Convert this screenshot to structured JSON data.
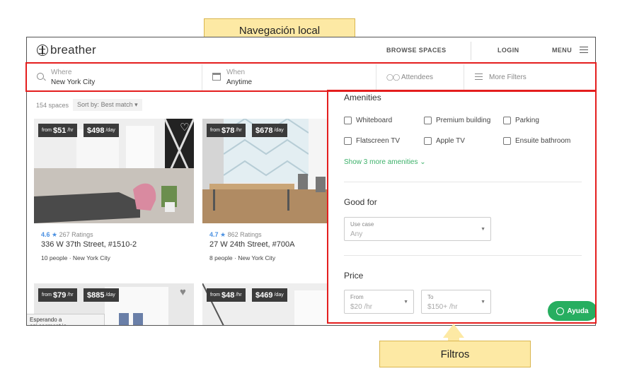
{
  "annotations": {
    "top_callout": "Navegación local",
    "bottom_callout": "Filtros"
  },
  "header": {
    "logo_text": "breather",
    "browse_label": "BROWSE SPACES",
    "login_label": "LOGIN",
    "menu_label": "MENU"
  },
  "search": {
    "where_label": "Where",
    "where_value": "New York City",
    "when_label": "When",
    "when_value": "Anytime",
    "attendees_label": "Attendees",
    "more_filters_label": "More Filters"
  },
  "results": {
    "count": "154 spaces",
    "sort_label": "Sort by:",
    "sort_value": "Best match",
    "cards": [
      {
        "from": "from",
        "hourly": "$51",
        "hourly_unit": "/hr",
        "daily": "$498",
        "daily_unit": "/day",
        "score": "4.6",
        "ratings": "267 Ratings",
        "address": "336 W 37th Street, #1510-2",
        "people": "10 people",
        "city": "New York City"
      },
      {
        "from": "from",
        "hourly": "$78",
        "hourly_unit": "/hr",
        "daily": "$678",
        "daily_unit": "/day",
        "score": "4.7",
        "ratings": "862 Ratings",
        "address": "27 W 24th Street, #700A",
        "people": "8 people",
        "city": "New York City"
      },
      {
        "from": "from",
        "hourly": "$79",
        "hourly_unit": "/hr",
        "daily": "$885",
        "daily_unit": "/day"
      },
      {
        "from": "from",
        "hourly": "$48",
        "hourly_unit": "/hr",
        "daily": "$469",
        "daily_unit": "/day"
      }
    ]
  },
  "status_bar": "Esperando a api.segment.io...",
  "filters": {
    "amenities_heading": "Amenities",
    "amenities": [
      "Whiteboard",
      "Premium building",
      "Parking",
      "Flatscreen TV",
      "Apple TV",
      "Ensuite bathroom"
    ],
    "show_more": "Show 3 more amenities",
    "good_for_heading": "Good for",
    "use_case_label": "Use case",
    "use_case_value": "Any",
    "price_heading": "Price",
    "from_label": "From",
    "from_value": "$20 /hr",
    "to_label": "To",
    "to_value": "$150+ /hr"
  },
  "help_button": "Ayuda",
  "colors": {
    "highlight": "#e41e1e",
    "callout": "#fde9a4",
    "accent_green": "#27ae60",
    "rating_blue": "#4a90e2"
  }
}
